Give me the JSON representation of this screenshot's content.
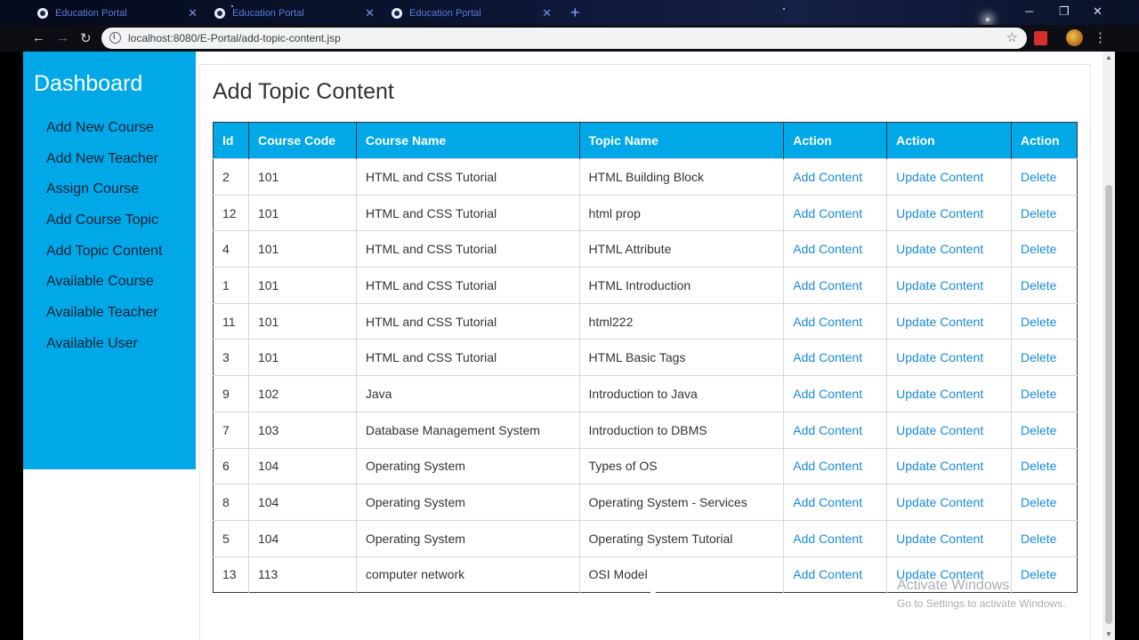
{
  "browser": {
    "tabs": [
      {
        "label": "Education Portal"
      },
      {
        "label": "Education Portal"
      },
      {
        "label": "Education Portal"
      }
    ],
    "url": "localhost:8080/E-Portal/add-topic-content.jsp"
  },
  "sidebar": {
    "brand": "Dashboard",
    "items": [
      {
        "label": "Add New Course"
      },
      {
        "label": "Add New Teacher"
      },
      {
        "label": "Assign Course"
      },
      {
        "label": "Add Course Topic"
      },
      {
        "label": "Add Topic Content"
      },
      {
        "label": "Available Course"
      },
      {
        "label": "Available Teacher"
      },
      {
        "label": "Available User"
      }
    ]
  },
  "main": {
    "title": "Add Topic Content",
    "columns": [
      "Id",
      "Course Code",
      "Course Name",
      "Topic Name",
      "Action",
      "Action",
      "Action"
    ],
    "rows": [
      {
        "id": "2",
        "code": "101",
        "course": "HTML and CSS Tutorial",
        "topic": "HTML Building Block",
        "add": "Add Content",
        "update": "Update Content",
        "delete": "Delete"
      },
      {
        "id": "12",
        "code": "101",
        "course": "HTML and CSS Tutorial",
        "topic": "html prop",
        "add": "Add Content",
        "update": "Update Content",
        "delete": "Delete"
      },
      {
        "id": "4",
        "code": "101",
        "course": "HTML and CSS Tutorial",
        "topic": "HTML Attribute",
        "add": "Add Content",
        "update": "Update Content",
        "delete": "Delete"
      },
      {
        "id": "1",
        "code": "101",
        "course": "HTML and CSS Tutorial",
        "topic": "HTML Introduction",
        "add": "Add Content",
        "update": "Update Content",
        "delete": "Delete"
      },
      {
        "id": "11",
        "code": "101",
        "course": "HTML and CSS Tutorial",
        "topic": "html222",
        "add": "Add Content",
        "update": "Update Content",
        "delete": "Delete"
      },
      {
        "id": "3",
        "code": "101",
        "course": "HTML and CSS Tutorial",
        "topic": "HTML Basic Tags",
        "add": "Add Content",
        "update": "Update Content",
        "delete": "Delete"
      },
      {
        "id": "9",
        "code": "102",
        "course": "Java",
        "topic": "Introduction to Java",
        "add": "Add Content",
        "update": "Update Content",
        "delete": "Delete"
      },
      {
        "id": "7",
        "code": "103",
        "course": "Database Management System",
        "topic": "Introduction to DBMS",
        "add": "Add Content",
        "update": "Update Content",
        "delete": "Delete"
      },
      {
        "id": "6",
        "code": "104",
        "course": "Operating System",
        "topic": "Types of OS",
        "add": "Add Content",
        "update": "Update Content",
        "delete": "Delete"
      },
      {
        "id": "8",
        "code": "104",
        "course": "Operating System",
        "topic": "Operating System - Services",
        "add": "Add Content",
        "update": "Update Content",
        "delete": "Delete"
      },
      {
        "id": "5",
        "code": "104",
        "course": "Operating System",
        "topic": "Operating System Tutorial",
        "add": "Add Content",
        "update": "Update Content",
        "delete": "Delete"
      },
      {
        "id": "13",
        "code": "113",
        "course": "computer network",
        "topic": "OSI Model",
        "add": "Add Content",
        "update": "Update Content",
        "delete": "Delete"
      }
    ]
  },
  "watermark": {
    "line1": "Activate Windows",
    "line2": "Go to Settings to activate Windows."
  },
  "colors": {
    "accent": "#00a8e8",
    "link": "#1a8ad8"
  }
}
